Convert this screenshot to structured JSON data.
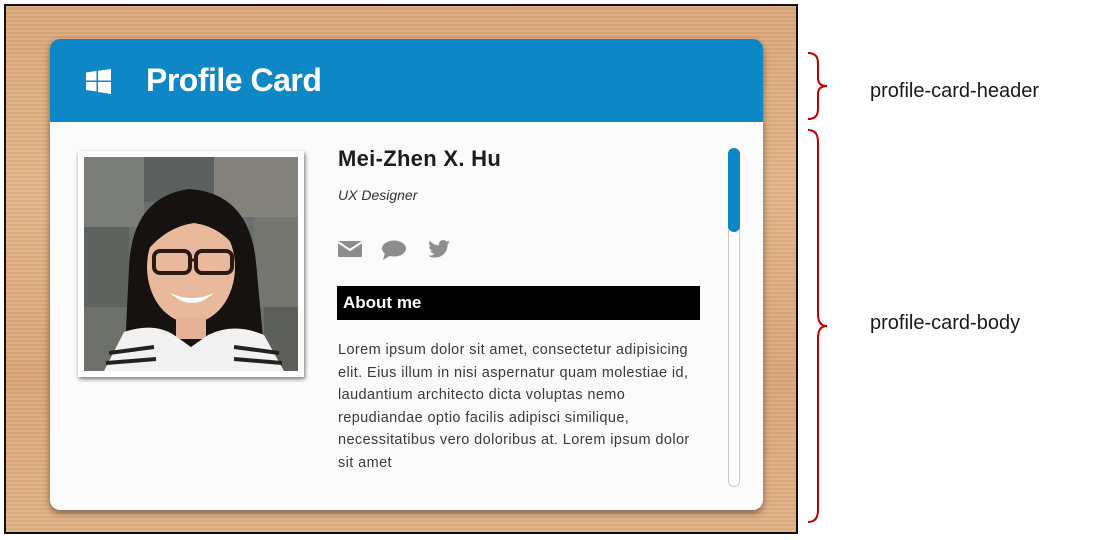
{
  "header": {
    "title": "Profile Card",
    "icon": "windows-icon"
  },
  "profile": {
    "name": "Mei-Zhen X. Hu",
    "role": "UX Designer",
    "social_icons": [
      "envelope-icon",
      "chat-bubble-icon",
      "twitter-icon"
    ],
    "about_heading": "About me",
    "about_text": "Lorem ipsum dolor sit amet, consectetur adipisicing elit. Eius illum in nisi aspernatur quam molestiae id, laudantium architecto dicta voluptas nemo repudiandae optio facilis adipisci similique, necessitatibus vero doloribus at. Lorem ipsum dolor sit amet"
  },
  "annotations": {
    "header_label": "profile-card-header",
    "body_label": "profile-card-body"
  },
  "colors": {
    "header_bg": "#0d87c5",
    "scroll_thumb": "#0d87c5",
    "annotation_brace": "#c00000",
    "about_bg": "#000000"
  }
}
